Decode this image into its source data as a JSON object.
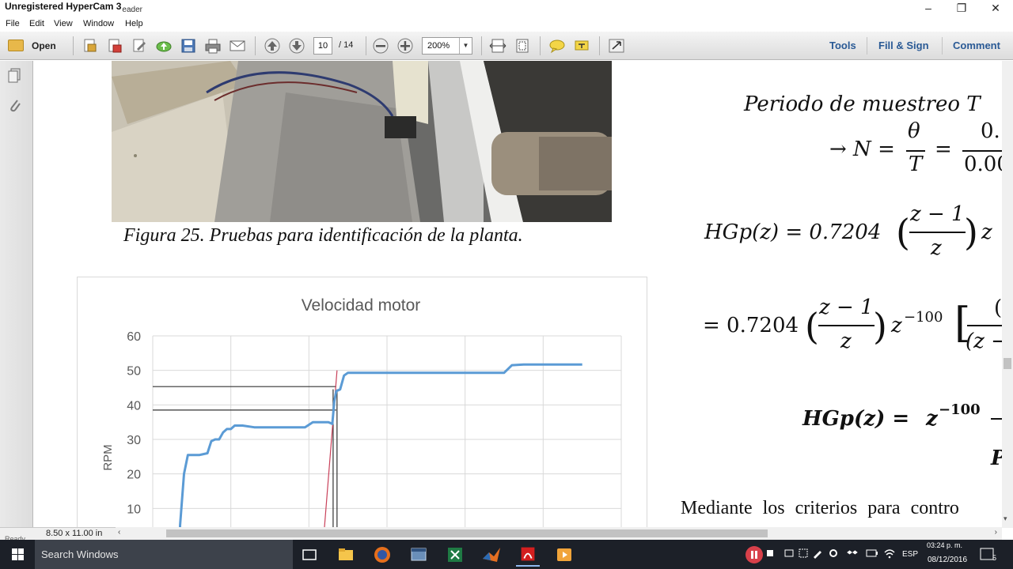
{
  "window": {
    "title": "Unregistered HyperCam 3",
    "title_underlay": "eader",
    "minimize": "–",
    "maximize": "❐",
    "close": "✕"
  },
  "menu": [
    "File",
    "Edit",
    "View",
    "Window",
    "Help"
  ],
  "toolbar": {
    "open_label": "Open",
    "page_current": "10",
    "page_total": "/ 14",
    "zoom": "200%",
    "tools_label": "Tools",
    "fill_sign_label": "Fill & Sign",
    "comment_label": "Comment"
  },
  "document": {
    "caption": "Figura 25. Pruebas para identificación de la planta.",
    "eq1_text": "Periodo de muestreo T",
    "eq2_arrow": "→ N =",
    "eq2_frac1_num": "θ",
    "eq2_frac1_den": "T",
    "eq2_eq": "=",
    "eq2_frac2_num": "0.",
    "eq2_frac2_den": "0.00",
    "eq3_lhs": "HGp(z) = 0.7204",
    "eq3_frac_num": "z − 1",
    "eq3_frac_den": "z",
    "eq3_tail": "z",
    "eq4_lhs": "= 0.7204",
    "eq4_frac_num": "z − 1",
    "eq4_frac_den": "z",
    "eq4_z": "z",
    "eq4_exp": "−100",
    "eq4_tail": "(z −",
    "eq5_lhs": "HGp(z) =",
    "eq5_z": "z",
    "eq5_exp": "−100",
    "eq6_partial": "P",
    "body_text": "Mediante los criterios para contro"
  },
  "chart_data": {
    "type": "line",
    "title": "Velocidad motor",
    "ylabel": "RPM",
    "xlabel": "",
    "ylim": [
      0,
      60
    ],
    "yticks": [
      10,
      20,
      30,
      40,
      50,
      60
    ],
    "grid": true,
    "series": [
      {
        "color": "#5b9bd5",
        "values": [
          [
            0.7,
            0
          ],
          [
            0.7,
            5
          ],
          [
            0.8,
            20
          ],
          [
            0.9,
            25.5
          ],
          [
            1.2,
            25.5
          ],
          [
            1.4,
            26
          ],
          [
            1.5,
            29.5
          ],
          [
            1.6,
            30
          ],
          [
            1.7,
            30
          ],
          [
            1.8,
            32
          ],
          [
            1.9,
            33
          ],
          [
            2.0,
            33
          ],
          [
            2.1,
            34
          ],
          [
            2.3,
            34
          ],
          [
            2.6,
            33.5
          ],
          [
            3.1,
            33.5
          ],
          [
            3.9,
            33.5
          ],
          [
            4.1,
            35
          ],
          [
            4.5,
            35
          ],
          [
            4.6,
            34.5
          ],
          [
            4.65,
            41
          ],
          [
            4.7,
            44
          ],
          [
            4.8,
            44.5
          ],
          [
            4.9,
            48.5
          ],
          [
            5.0,
            49.3
          ],
          [
            5.5,
            49.3
          ],
          [
            6.5,
            49.3
          ],
          [
            9.0,
            49.3
          ],
          [
            9.2,
            51.5
          ],
          [
            9.5,
            51.7
          ],
          [
            11,
            51.7
          ]
        ]
      }
    ],
    "reference_lines": [
      {
        "color": "#333333",
        "y": 45.3
      },
      {
        "color": "#333333",
        "y": 38.5
      }
    ],
    "tangent_color": "#c9415a"
  },
  "status": {
    "page_size": "8.50 x 11.00 in",
    "ready": "Ready"
  },
  "taskbar": {
    "search_placeholder": "Search Windows",
    "lang": "ESP",
    "time": "03:24 p. m.",
    "date": "08/12/2016",
    "notifications": "5"
  },
  "colors": {
    "accent_link": "#2a5a95",
    "taskbar": "#1c2028",
    "series": "#5b9bd5"
  }
}
